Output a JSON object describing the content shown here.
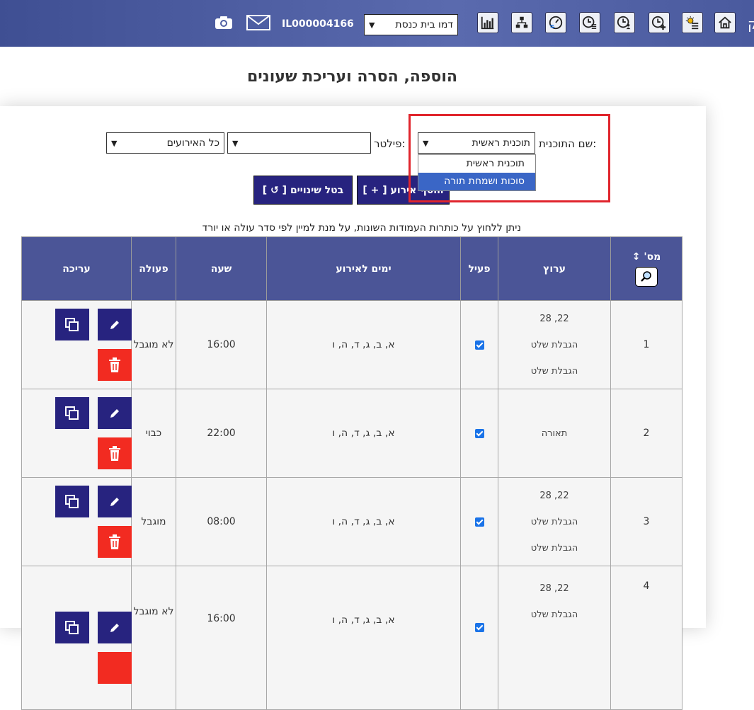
{
  "topbar": {
    "edge_char": "ק",
    "synagogue_select": "דמו בית כנסת",
    "account_id": "IL000004166",
    "icons": [
      "home-icon",
      "weather-icon",
      "clock-add-icon",
      "clock-person-icon",
      "clock-list-icon",
      "speed-timer-icon",
      "sitemap-icon",
      "bar-chart-icon"
    ]
  },
  "page": {
    "title": "הוספה, הסרה ועריכת שעונים"
  },
  "filters": {
    "program_label": "שם התוכנית:",
    "program_value": "תוכנית ראשית",
    "filter_label": "פילטר:",
    "filter_value": "",
    "events_value": "כל האירועים",
    "dropdown_options": [
      "תוכנית ראשית",
      "סוכות ושמחת תורה"
    ],
    "dropdown_selected_index": 1
  },
  "buttons": {
    "add_event": "[ + ] הוסף אירוע",
    "cancel_changes": "[ ↺ ] בטל שינויים"
  },
  "hint": "ניתן ללחוץ על כותרות העמודות השונות, על מנת למיין לפי סדר עולה או יורד",
  "table": {
    "headers": {
      "num": "מס' ↕",
      "route": "ערוץ",
      "active": "פעיל",
      "days": "ימים לאירוע",
      "time": "שעה",
      "action": "פעולה",
      "edit": "עריכה"
    },
    "rows": [
      {
        "num": "1",
        "route": [
          "22, 28",
          "הגבלת שלט",
          "הגבלת שלט"
        ],
        "days": "א, ב, ג, ד, ה, ו",
        "time": "16:00",
        "action": "לא מוגבל"
      },
      {
        "num": "2",
        "route": [
          "תאורה"
        ],
        "days": "א, ב, ג, ד, ה, ו",
        "time": "22:00",
        "action": "כבוי"
      },
      {
        "num": "3",
        "route": [
          "22, 28",
          "הגבלת שלט",
          "הגבלת שלט"
        ],
        "days": "א, ב, ג, ד, ה, ו",
        "time": "08:00",
        "action": "מוגבל"
      },
      {
        "num": "4",
        "route": [
          "22, 28",
          "הגבלת שלט"
        ],
        "days": "א, ב, ג, ד, ה, ו",
        "time": "16:00",
        "action": "לא מוגבל"
      }
    ]
  },
  "colors": {
    "header_bg": "#4b5597",
    "button_dark": "#27237f",
    "delete_red": "#f22b21",
    "highlight_red": "#e0252d"
  }
}
